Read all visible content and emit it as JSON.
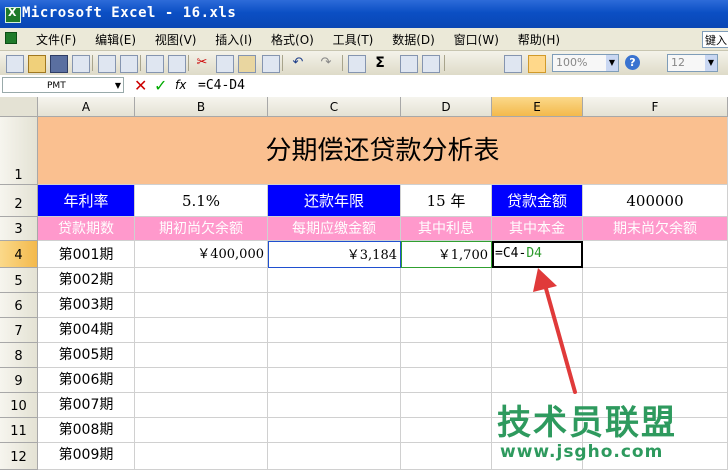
{
  "window": {
    "title": "Microsoft Excel - 16.xls"
  },
  "menu": {
    "items": [
      "文件(F)",
      "编辑(E)",
      "视图(V)",
      "插入(I)",
      "格式(O)",
      "工具(T)",
      "数据(D)",
      "窗口(W)",
      "帮助(H)"
    ],
    "help_box": "键入"
  },
  "toolbar": {
    "zoom": "100%",
    "font_size": "12",
    "sigma": "Σ",
    "help_icon": "?"
  },
  "formula_bar": {
    "name_box": "PMT",
    "cancel": "✕",
    "enter": "✓",
    "fx": "fx",
    "value": "=C4-D4"
  },
  "columns": [
    "A",
    "B",
    "C",
    "D",
    "E",
    "F"
  ],
  "rows": [
    "1",
    "2",
    "3",
    "4",
    "5",
    "6",
    "7",
    "8",
    "9",
    "10",
    "11",
    "12"
  ],
  "sheet": {
    "title": "分期偿还贷款分析表",
    "row2": {
      "a": "年利率",
      "b": "5.1%",
      "c": "还款年限",
      "d": "15 年",
      "e": "贷款金额",
      "f": "400000"
    },
    "row3": [
      "贷款期数",
      "期初尚欠余额",
      "每期应缴金额",
      "其中利息",
      "其中本金",
      "期末尚欠余额"
    ],
    "row4": {
      "b": "￥400,000",
      "c": "￥3,184",
      "d": "￥1,700",
      "e_prefix": "=C4-",
      "e_ref": "D4"
    },
    "periods": [
      "第001期",
      "第002期",
      "第003期",
      "第004期",
      "第005期",
      "第006期",
      "第007期",
      "第008期",
      "第009期"
    ]
  },
  "colors": {
    "header_blue": "#0000ff",
    "title_fill": "#fac090",
    "pink": "#ff99cc",
    "arrow": "#e03a3a"
  },
  "watermark": {
    "text": "技术员联盟",
    "url": "www.jsgho.com"
  }
}
